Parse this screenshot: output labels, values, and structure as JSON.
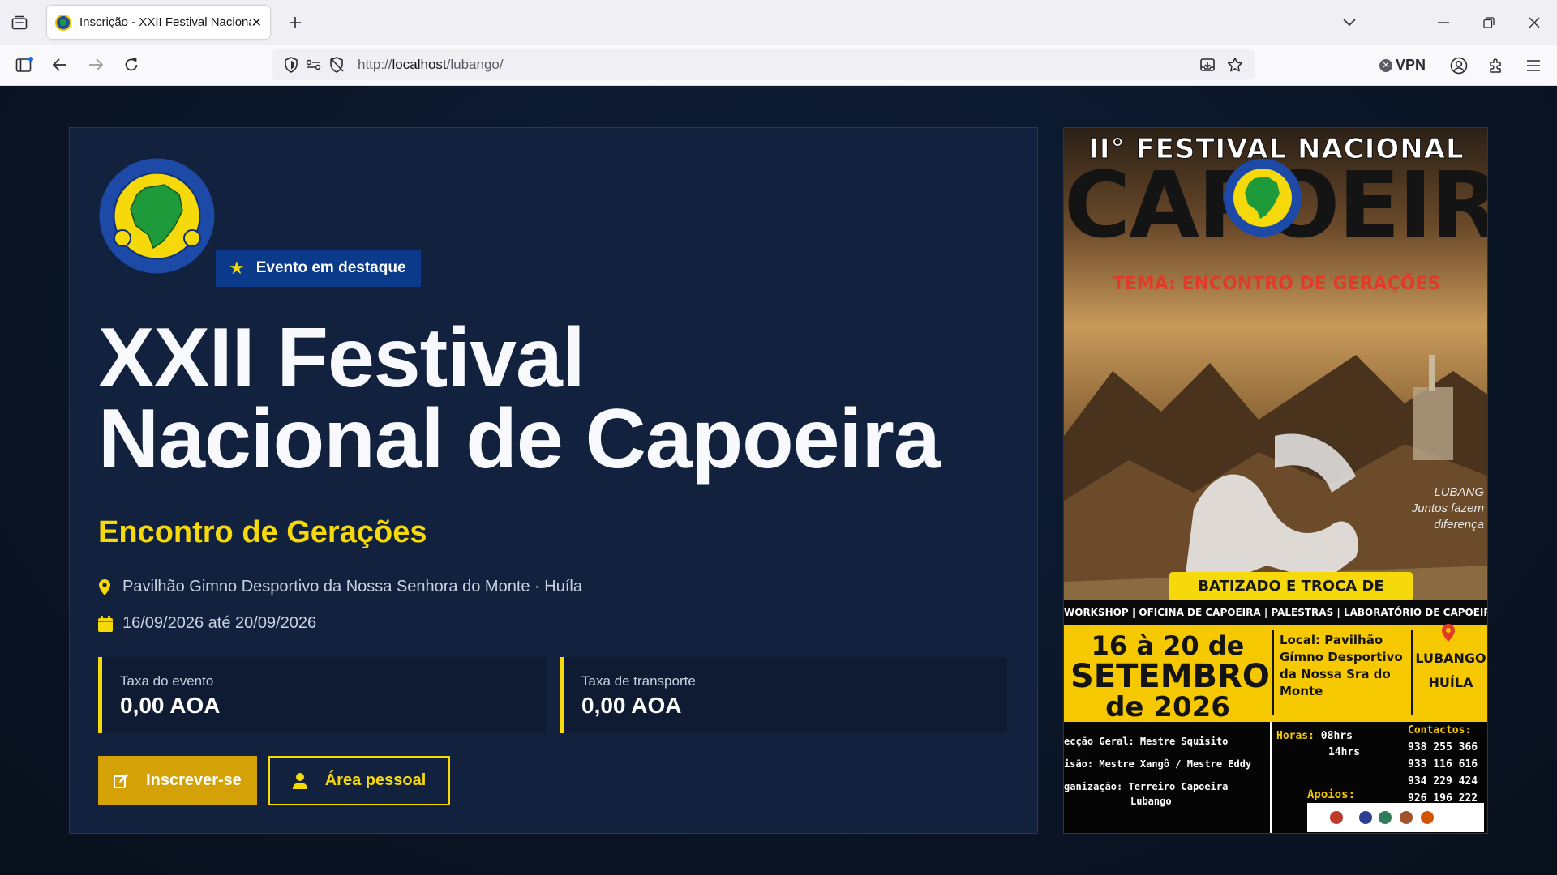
{
  "browser": {
    "tab_title": "Inscrição - XXII Festival Nacional de Capoeira",
    "url_prefix": "http://",
    "url_host": "localhost",
    "url_path": "/lubango/",
    "vpn_label": "VPN"
  },
  "event": {
    "badge": "Evento em destaque",
    "title_line1": "XXII Festival",
    "title_line2": "Nacional de Capoeira",
    "subtitle": "Encontro de Gerações",
    "location": "Pavilhão Gimno Desportivo da Nossa Senhora do Monte · Huíla",
    "dates": "16/09/2026 até 20/09/2026",
    "fees": [
      {
        "label": "Taxa do evento",
        "value": "0,00 AOA"
      },
      {
        "label": "Taxa de transporte",
        "value": "0,00 AOA"
      }
    ],
    "register_label": "Inscrever-se",
    "personal_area_label": "Área pessoal"
  },
  "poster": {
    "headline_top": "II° FESTIVAL NACIONAL DE",
    "headline_main": "CAPOEIRA",
    "theme": "TEMA: ENCONTRO DE GERAÇÕES",
    "side_text_1": "LUBANG",
    "side_text_2": "Juntos fazem",
    "side_text_3": "diferença",
    "batizado": "BATIZADO E TROCA DE CORDAS",
    "activities": "WORKSHOP | OFICINA DE CAPOEIRA | PALESTRAS | LABORATÓRIO DE CAPOEIRA",
    "date_line1": "16 à 20 de",
    "date_line2": "SETEMBRO",
    "date_line3": "de 2026",
    "local": "Local: Pavilhão Gímno Desportivo da Nossa Sra do Monte",
    "city1": "LUBANGO",
    "city2": "HUÍLA",
    "credit1": "ecção Geral: Mestre Squisito",
    "credit2": "isão: Mestre Xangô / Mestre Eddy",
    "credit3": "ganização: Terreiro Capoeira",
    "credit4": "Lubango",
    "hours_label": "Horas:",
    "hours1": "08hrs",
    "hours2": "14hrs",
    "contacts_label": "Contactos:",
    "contacts": [
      "938 255 366",
      "933 116 616",
      "934 229 424",
      "926 196 222"
    ],
    "apoios": "Apoios:"
  }
}
